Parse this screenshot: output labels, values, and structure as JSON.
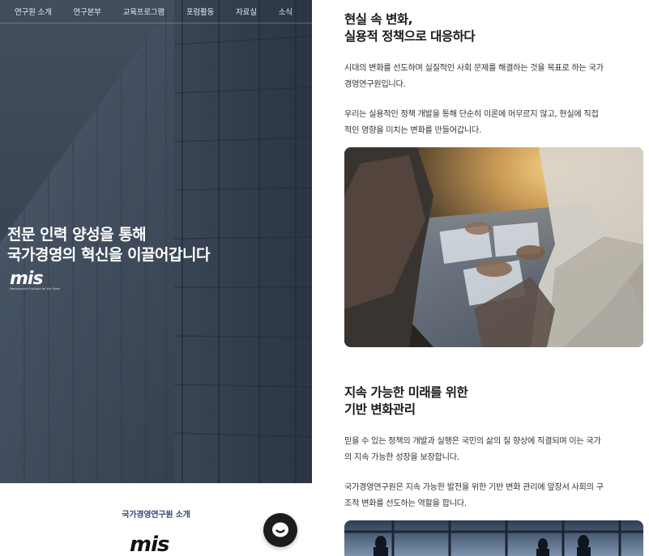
{
  "nav": {
    "items": [
      {
        "label": "연구원 소개"
      },
      {
        "label": "연구본부"
      },
      {
        "label": "교육프로그램"
      },
      {
        "label": "포럼활동"
      },
      {
        "label": "자료실"
      },
      {
        "label": "소식"
      }
    ]
  },
  "hero": {
    "headline_line1": "전문 인력 양성을 통해",
    "headline_line2": "국가경영의 혁신을 이끌어갑니다",
    "logo_text": "mis",
    "logo_sub": "Management Institute for the State"
  },
  "intro": {
    "title": "국가경영연구원 소개",
    "logo_text": "mis"
  },
  "chat": {
    "icon": "chat-bubble-icon"
  },
  "section1": {
    "title_line1": "현실 속 변화,",
    "title_line2": "실용적 정책으로 대응하다",
    "para1_line1": "시대의 변화를 선도하며 실질적인 사회 문제를 해결하는 것을 목표로 하는 국가",
    "para1_line2": "경영연구원입니다.",
    "para2_line1": "우리는 실용적인 정책 개발을 통해 단순히 이론에 머무르지 않고, 현실에 직접",
    "para2_line2": "적인 영향을 미치는 변화를 만들어갑니다."
  },
  "section2": {
    "title_line1": "지속 가능한 미래를 위한",
    "title_line2": "기반 변화관리",
    "para1_line1": "믿을 수 있는 정책의 개발과 실행은 국민의 삶의 질 향상에 직결되며 이는 국가",
    "para1_line2": "의 지속 가능한 성장을 보장합니다.",
    "para2_line1": "국가경영연구원은 지속 가능한 발전을 위한 기반 변화 관리에 앞장서 사회의 구",
    "para2_line2": "조적 변화를 선도하는 역할을 합니다."
  },
  "colors": {
    "hero_overlay": "#2d3a4a",
    "intro_title": "#2f4a74",
    "logo_accent": "#c8262b",
    "chat_button": "#1c1c1c"
  }
}
